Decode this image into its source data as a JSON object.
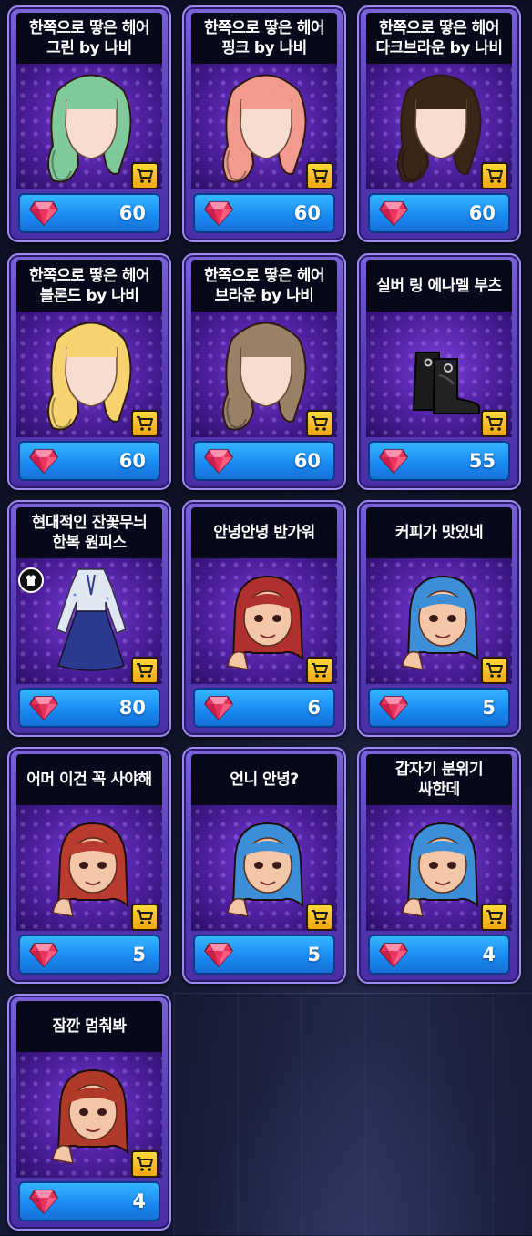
{
  "shop": {
    "items": [
      {
        "title": "한쪽으로 땋은 헤어\n그린 by 나비",
        "price": "60",
        "icon": "hair-green-icon",
        "color": "#7fc99a"
      },
      {
        "title": "한쪽으로 땋은 헤어\n핑크 by 나비",
        "price": "60",
        "icon": "hair-pink-icon",
        "color": "#f29a8e"
      },
      {
        "title": "한쪽으로 땋은 헤어\n다크브라운 by 나비",
        "price": "60",
        "icon": "hair-darkbrown-icon",
        "color": "#3a2519"
      },
      {
        "title": "한쪽으로 땋은 헤어\n블론드 by 나비",
        "price": "60",
        "icon": "hair-blonde-icon",
        "color": "#f6d36e"
      },
      {
        "title": "한쪽으로 땋은 헤어\n브라운 by 나비",
        "price": "60",
        "icon": "hair-brown-icon",
        "color": "#9a8067"
      },
      {
        "title": "실버 링 에나멜 부츠",
        "price": "55",
        "icon": "boots-icon",
        "color": "#1a1a1a"
      },
      {
        "title": "현대적인 잔꽃무늬\n한복 원피스",
        "price": "80",
        "icon": "hanbok-dress-icon",
        "color": "#2b3a8f"
      },
      {
        "title": "안녕안녕 반가워",
        "price": "6",
        "icon": "sticker-greeting-icon",
        "color": "#b0302e"
      },
      {
        "title": "커피가 맛있네",
        "price": "5",
        "icon": "sticker-coffee-icon",
        "color": "#3c8fd6"
      },
      {
        "title": "어머 이건 꼭 사야해",
        "price": "5",
        "icon": "sticker-must-buy-icon",
        "color": "#b93a2e"
      },
      {
        "title": "언니 안녕?",
        "price": "5",
        "icon": "sticker-hello-sis-icon",
        "color": "#3c8fd6"
      },
      {
        "title": "갑자기 분위기\n싸한데",
        "price": "4",
        "icon": "sticker-awkward-icon",
        "color": "#3c8fd6"
      },
      {
        "title": "잠깐 멈춰봐",
        "price": "4",
        "icon": "sticker-wait-icon",
        "color": "#b03a2a"
      }
    ]
  },
  "accent": {
    "price_bar": "#1a86f2",
    "cart": "#ffd93b",
    "gem": "#e8335c"
  }
}
